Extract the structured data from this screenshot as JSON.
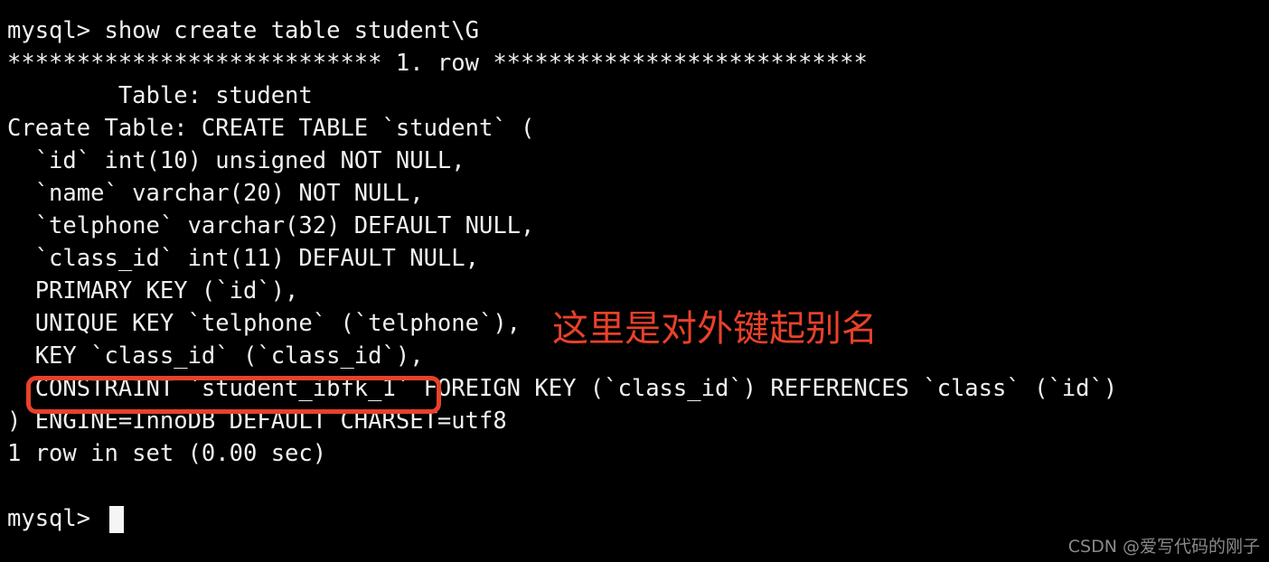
{
  "terminal": {
    "background_color": "#000000",
    "foreground_color": "#f0f0f0",
    "accent_red": "#e8412a",
    "watermark_color": "#8a8a8a",
    "lines": [
      "mysql> show create table student\\G",
      "*************************** 1. row ***************************",
      "        Table: student",
      "Create Table: CREATE TABLE `student` (",
      "  `id` int(10) unsigned NOT NULL,",
      "  `name` varchar(20) NOT NULL,",
      "  `telphone` varchar(32) DEFAULT NULL,",
      "  `class_id` int(11) DEFAULT NULL,",
      "  PRIMARY KEY (`id`),",
      "  UNIQUE KEY `telphone` (`telphone`),",
      "  KEY `class_id` (`class_id`),",
      "  CONSTRAINT `student_ibfk_1` FOREIGN KEY (`class_id`) REFERENCES `class` (`id`)",
      ") ENGINE=InnoDB DEFAULT CHARSET=utf8",
      "1 row in set (0.00 sec)",
      "",
      "mysql> "
    ],
    "command": "show create table student\\G",
    "prompt": "mysql> ",
    "result_status": "1 row in set (0.00 sec)",
    "row_separator": "*************************** 1. row ***************************",
    "table_name": "student",
    "engine": "InnoDB",
    "charset": "utf8"
  },
  "annotation": {
    "text": "这里是对外键起别名",
    "color": "#e8412a"
  },
  "highlight": {
    "target_text": "CONSTRAINT `student_ibfk_1`",
    "color": "#e8412a"
  },
  "watermark": {
    "text": "CSDN @爱写代码的刚子"
  }
}
